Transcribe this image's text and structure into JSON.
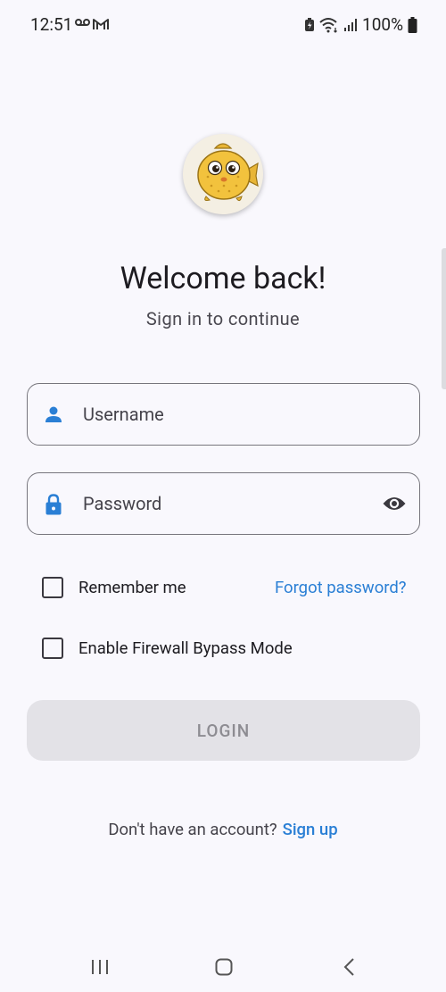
{
  "status_bar": {
    "time": "12:51",
    "battery_percent": "100%"
  },
  "app": {
    "title": "Welcome back!",
    "subtitle": "Sign in to continue"
  },
  "form": {
    "username_placeholder": "Username",
    "password_placeholder": "Password",
    "remember_me_label": "Remember me",
    "forgot_password_label": "Forgot password?",
    "firewall_bypass_label": "Enable Firewall Bypass Mode",
    "login_label": "LOGIN",
    "remember_me_checked": false,
    "firewall_bypass_checked": false
  },
  "signup": {
    "prompt": "Don't have an account?",
    "link": "Sign up"
  },
  "colors": {
    "accent": "#2a7fd5",
    "background": "#f9f8fd",
    "button_disabled_bg": "#e3e2e7",
    "button_disabled_text": "#8d8c92"
  },
  "icons": {
    "username": "person-icon",
    "password": "lock-icon",
    "password_toggle": "eye-icon"
  }
}
